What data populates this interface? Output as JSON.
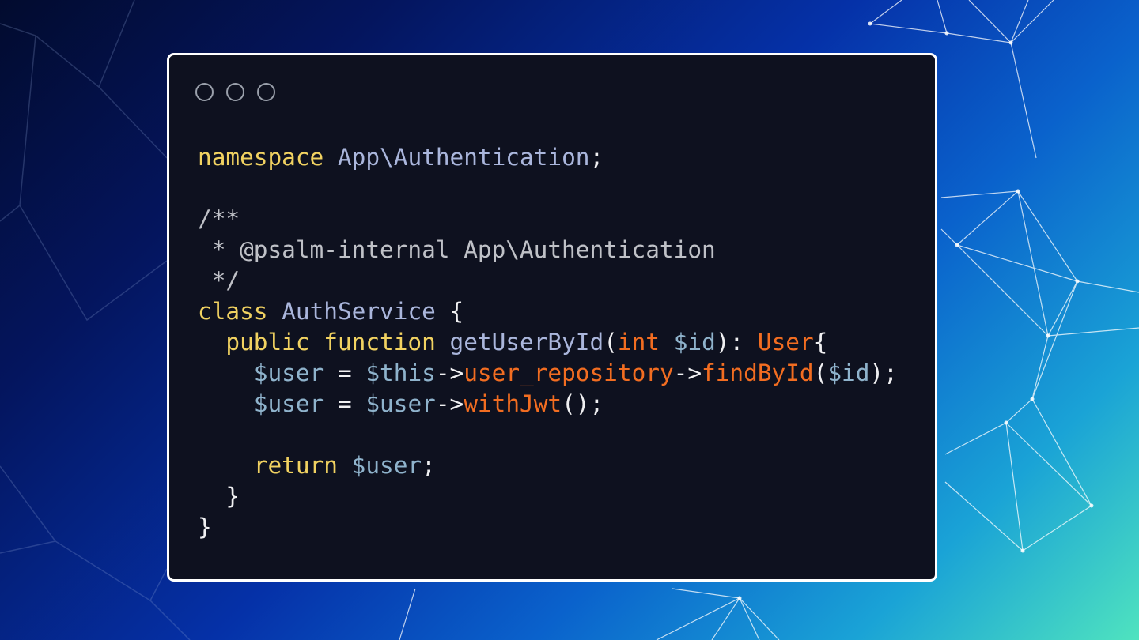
{
  "window": {
    "controls": [
      "close",
      "minimize",
      "maximize"
    ]
  },
  "code": {
    "language": "php",
    "lines": [
      [
        {
          "t": "namespace",
          "c": "kw"
        },
        {
          "t": " ",
          "c": "pn"
        },
        {
          "t": "App\\Authentication",
          "c": "ns"
        },
        {
          "t": ";",
          "c": "pn"
        }
      ],
      [],
      [
        {
          "t": "/**",
          "c": "cmt"
        }
      ],
      [
        {
          "t": " * @psalm-internal App\\Authentication",
          "c": "cmt"
        }
      ],
      [
        {
          "t": " */",
          "c": "cmt"
        }
      ],
      [
        {
          "t": "class",
          "c": "kw"
        },
        {
          "t": " ",
          "c": "pn"
        },
        {
          "t": "AuthService",
          "c": "cls"
        },
        {
          "t": " {",
          "c": "pn"
        }
      ],
      [
        {
          "t": "  ",
          "c": "pn"
        },
        {
          "t": "public",
          "c": "kw"
        },
        {
          "t": " ",
          "c": "pn"
        },
        {
          "t": "function",
          "c": "kw"
        },
        {
          "t": " ",
          "c": "pn"
        },
        {
          "t": "getUserById",
          "c": "fn"
        },
        {
          "t": "(",
          "c": "pn"
        },
        {
          "t": "int",
          "c": "type"
        },
        {
          "t": " ",
          "c": "pn"
        },
        {
          "t": "$id",
          "c": "var"
        },
        {
          "t": "): ",
          "c": "pn"
        },
        {
          "t": "User",
          "c": "type"
        },
        {
          "t": "{",
          "c": "pn"
        }
      ],
      [
        {
          "t": "    ",
          "c": "pn"
        },
        {
          "t": "$user",
          "c": "var"
        },
        {
          "t": " = ",
          "c": "pn"
        },
        {
          "t": "$this",
          "c": "var"
        },
        {
          "t": "->",
          "c": "pn"
        },
        {
          "t": "user_repository",
          "c": "prop"
        },
        {
          "t": "->",
          "c": "pn"
        },
        {
          "t": "findById",
          "c": "meth"
        },
        {
          "t": "(",
          "c": "pn"
        },
        {
          "t": "$id",
          "c": "var"
        },
        {
          "t": ");",
          "c": "pn"
        }
      ],
      [
        {
          "t": "    ",
          "c": "pn"
        },
        {
          "t": "$user",
          "c": "var"
        },
        {
          "t": " = ",
          "c": "pn"
        },
        {
          "t": "$user",
          "c": "var"
        },
        {
          "t": "->",
          "c": "pn"
        },
        {
          "t": "withJwt",
          "c": "meth"
        },
        {
          "t": "();",
          "c": "pn"
        }
      ],
      [],
      [
        {
          "t": "    ",
          "c": "pn"
        },
        {
          "t": "return",
          "c": "kw"
        },
        {
          "t": " ",
          "c": "pn"
        },
        {
          "t": "$user",
          "c": "var"
        },
        {
          "t": ";",
          "c": "pn"
        }
      ],
      [
        {
          "t": "  }",
          "c": "pn"
        }
      ],
      [
        {
          "t": "}",
          "c": "pn"
        }
      ]
    ]
  },
  "colors": {
    "window_bg": "#0e111f",
    "window_border": "#ffffff",
    "keyword": "#f1d261",
    "identifier": "#aab6dc",
    "comment": "#bfc1c7",
    "type_and_member": "#f26d21",
    "variable": "#8fb3cc",
    "punctuation": "#f0f0f2"
  }
}
